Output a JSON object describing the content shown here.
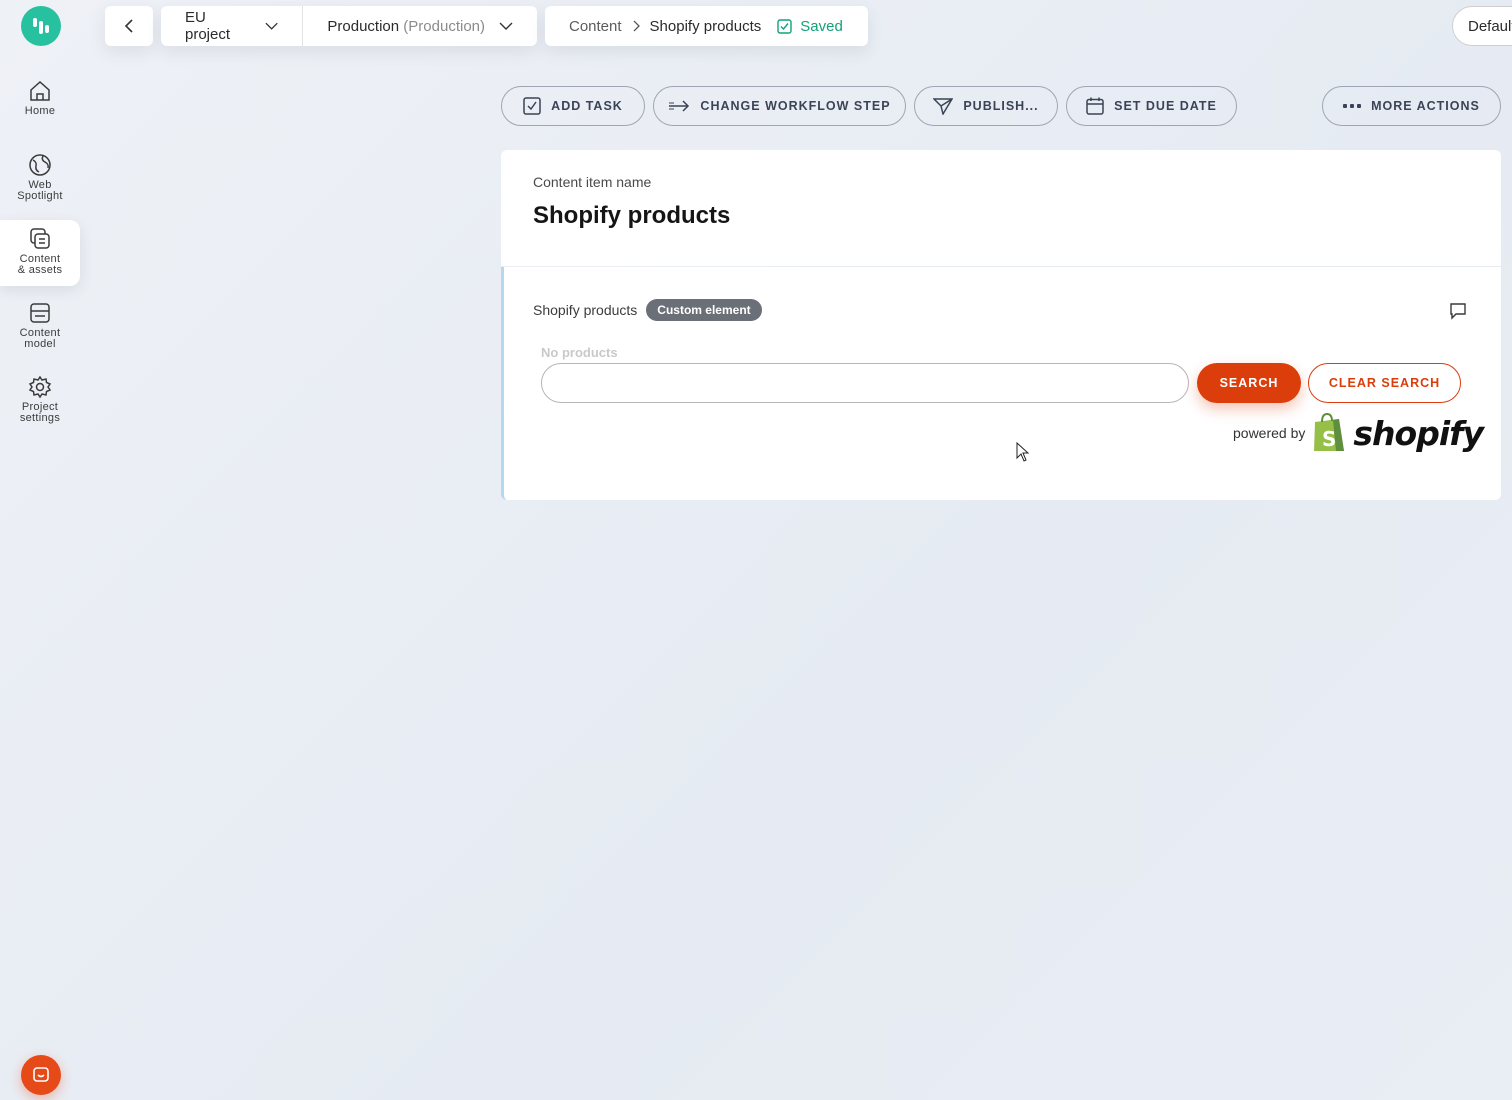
{
  "app": {
    "brand_color": "#27c19f",
    "accent_color": "#db3d0b"
  },
  "nav": {
    "items": [
      {
        "label": "Home",
        "icon": "home-icon"
      },
      {
        "label": "Web\nSpotlight",
        "icon": "globe-icon"
      },
      {
        "label": "Content\n& assets",
        "icon": "content-assets-icon",
        "active": true
      },
      {
        "label": "Content\nmodel",
        "icon": "content-model-icon"
      },
      {
        "label": "Project\nsettings",
        "icon": "gear-icon"
      }
    ]
  },
  "topbar": {
    "project": "EU project",
    "environment": "Production",
    "environment_note": "(Production)",
    "breadcrumb": [
      "Content",
      "Shopify products"
    ],
    "status": "Saved",
    "default_btn": "Default"
  },
  "actions": {
    "add_task": "ADD TASK",
    "change_workflow": "CHANGE WORKFLOW STEP",
    "publish": "PUBLISH...",
    "set_due_date": "SET DUE DATE",
    "more_actions": "MORE ACTIONS"
  },
  "item": {
    "name_label": "Content item name",
    "name": "Shopify products"
  },
  "element": {
    "label": "Shopify products",
    "badge": "Custom element",
    "no_products": "No products",
    "search_value": "",
    "search_button": "SEARCH",
    "clear_button": "CLEAR SEARCH",
    "powered_by": "powered by",
    "shopify_logo": "shopify"
  }
}
